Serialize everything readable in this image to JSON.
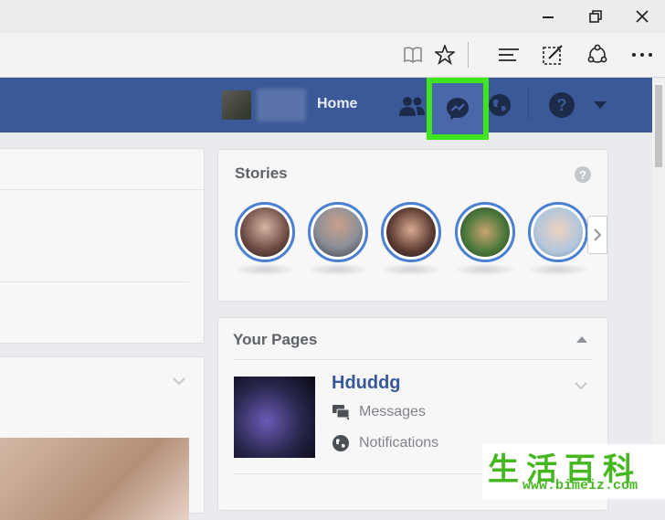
{
  "fb_header": {
    "home_label": "Home"
  },
  "icons": {
    "reading": "book-icon",
    "favorite": "star-icon",
    "hub": "hub-lines-icon",
    "notes": "web-note-icon",
    "share": "share-icon",
    "more": "more-dots-icon",
    "friends": "friend-requests-icon",
    "messenger": "messenger-icon",
    "notifications": "globe-icon",
    "help": "help-icon",
    "account": "caret-down-icon"
  },
  "stories": {
    "title": "Stories",
    "help_glyph": "?"
  },
  "pages": {
    "title": "Your Pages",
    "page_name": "Hduddg",
    "messages_label": "Messages",
    "notifications_label": "Notifications"
  },
  "colors": {
    "facebook_blue": "#3b5998",
    "highlight": "#3fe61f"
  },
  "watermark": {
    "chinese": "生活百科",
    "url": "www.bimeiz.com"
  }
}
